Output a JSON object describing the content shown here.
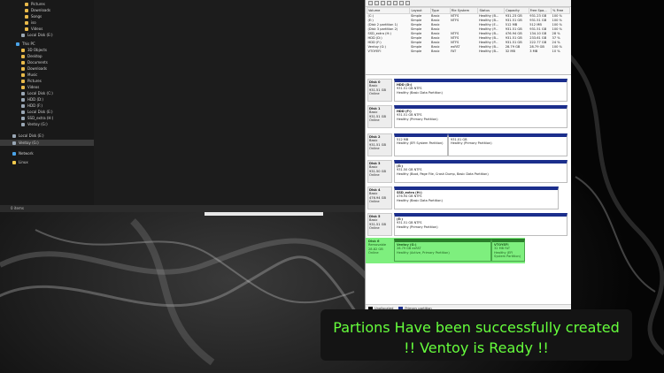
{
  "explorer": {
    "nav_items": [
      {
        "label": "Pictures",
        "icon": "folder-icon"
      },
      {
        "label": "Downloads",
        "icon": "folder-icon"
      },
      {
        "label": "Songs",
        "icon": "folder-icon"
      },
      {
        "label": "iso",
        "icon": "folder-icon"
      },
      {
        "label": "Videos",
        "icon": "folder-icon"
      },
      {
        "label": "Local Disk (E:)",
        "icon": "drive-icon"
      },
      {
        "label": "This PC",
        "icon": "computer-icon"
      },
      {
        "label": "3D Objects",
        "icon": "folder-icon"
      },
      {
        "label": "Desktop",
        "icon": "folder-icon"
      },
      {
        "label": "Documents",
        "icon": "folder-icon"
      },
      {
        "label": "Downloads",
        "icon": "folder-icon"
      },
      {
        "label": "Music",
        "icon": "folder-icon"
      },
      {
        "label": "Pictures",
        "icon": "folder-icon"
      },
      {
        "label": "Videos",
        "icon": "folder-icon"
      },
      {
        "label": "Local Disk (C:)",
        "icon": "drive-icon"
      },
      {
        "label": "HDD (D:)",
        "icon": "drive-icon"
      },
      {
        "label": "HDD (F:)",
        "icon": "drive-icon"
      },
      {
        "label": "Local Disk (E:)",
        "icon": "drive-icon"
      },
      {
        "label": "SSD_extra (H:)",
        "icon": "drive-icon"
      },
      {
        "label": "Ventoy (G:)",
        "icon": "drive-icon"
      },
      {
        "label": "Local Disk (E:)",
        "icon": "drive-icon"
      },
      {
        "label": "Ventoy (G:)",
        "icon": "drive-icon"
      },
      {
        "label": "Network",
        "icon": "network-icon"
      },
      {
        "label": "Linux",
        "icon": "linux-icon"
      }
    ],
    "status_text": "0 items"
  },
  "disk_management": {
    "columns": [
      "Volume",
      "Layout",
      "Type",
      "File System",
      "Status",
      "Capacity",
      "Free Spa...",
      "% Free"
    ],
    "volumes": [
      [
        "(C:)",
        "Simple",
        "Basic",
        "NTFS",
        "Healthy (B...",
        "931.23 GB",
        "931.23 GB",
        "100 %"
      ],
      [
        "(E:)",
        "Simple",
        "Basic",
        "NTFS",
        "Healthy (B...",
        "931.51 GB",
        "931.51 GB",
        "100 %"
      ],
      [
        "(Disk 2 partition 1)",
        "Simple",
        "Basic",
        "",
        "Healthy (E...",
        "512 MB",
        "512 MB",
        "100 %"
      ],
      [
        "(Disk 3 partition 2)",
        "Simple",
        "Basic",
        "",
        "Healthy (P...",
        "931.51 GB",
        "931.51 GB",
        "100 %"
      ],
      [
        "SSD_extra (H:)",
        "Simple",
        "Basic",
        "NTFS",
        "Healthy (B...",
        "476.94 GB",
        "134.10 GB",
        "28 %"
      ],
      [
        "HDD (D:)",
        "Simple",
        "Basic",
        "NTFS",
        "Healthy (B...",
        "931.51 GB",
        "233.61 GB",
        "37 %"
      ],
      [
        "HDD (F:)",
        "Simple",
        "Basic",
        "NTFS",
        "Healthy (P...",
        "931.51 GB",
        "222.77 GB",
        "24 %"
      ],
      [
        "Ventoy (G:)",
        "Simple",
        "Basic",
        "exFAT",
        "Healthy (B...",
        "28.79 GB",
        "28.79 GB",
        "100 %"
      ],
      [
        "VTOYEFI",
        "Simple",
        "Basic",
        "FAT",
        "Healthy (B...",
        "32 MB",
        "3 MB",
        "10 %"
      ]
    ],
    "disks": [
      {
        "name": "Disk 0",
        "type": "Basic",
        "size": "931.51 GB",
        "state": "Online",
        "parts": [
          {
            "name": "HDD (D:)",
            "line1": "931.51 GB NTFS",
            "line2": "Healthy (Basic Data Partition)"
          }
        ]
      },
      {
        "name": "Disk 1",
        "type": "Basic",
        "size": "931.51 GB",
        "state": "Online",
        "parts": [
          {
            "name": "HDD (F:)",
            "line1": "931.51 GB NTFS",
            "line2": "Healthy (Primary Partition)"
          }
        ]
      },
      {
        "name": "Disk 2",
        "type": "Basic",
        "size": "931.51 GB",
        "state": "Online",
        "parts": [
          {
            "name": "",
            "line1": "512 MB",
            "line2": "Healthy (EFI System Partition)"
          },
          {
            "name": "",
            "line1": "931.01 GB",
            "line2": "Healthy (Primary Partition)"
          }
        ]
      },
      {
        "name": "Disk 3",
        "type": "Basic",
        "size": "931.50 GB",
        "state": "Online",
        "parts": [
          {
            "name": "(E:)",
            "line1": "931.50 GB NTFS",
            "line2": "Healthy (Boot, Page File, Crash Dump, Basic Data Partition)"
          }
        ]
      },
      {
        "name": "Disk 4",
        "type": "Basic",
        "size": "476.94 GB",
        "state": "Online",
        "parts": [
          {
            "name": "SSD_extra (H:)",
            "line1": "476.94 GB NTFS",
            "line2": "Healthy (Basic Data Partition)"
          }
        ]
      },
      {
        "name": "Disk 5",
        "type": "Basic",
        "size": "931.51 GB",
        "state": "Online",
        "parts": [
          {
            "name": "(E:)",
            "line1": "931.51 GB NTFS",
            "line2": "Healthy (Primary Partition)"
          }
        ]
      }
    ],
    "usb_disk": {
      "name": "Disk 6",
      "type": "Removable",
      "size": "28.82 GB",
      "state": "Online",
      "parts": [
        {
          "name": "Ventoy (G:)",
          "line1": "28.79 GB exFAT",
          "line2": "Healthy (Active, Primary Partition)"
        },
        {
          "name": "VTOYEFI",
          "line1": "32 MB FAT",
          "line2": "Healthy (EFI System Partition)"
        }
      ]
    },
    "legend": {
      "unallocated": "Unallocated",
      "primary": "Primary partition"
    }
  },
  "caption": {
    "line1": "Partions Have been successfully created",
    "line2": "!! Ventoy is Ready !!"
  },
  "colors": {
    "caption_text": "#66ff3c",
    "partition_bar": "#1b2e8c",
    "highlight": "#5aeb5a"
  }
}
